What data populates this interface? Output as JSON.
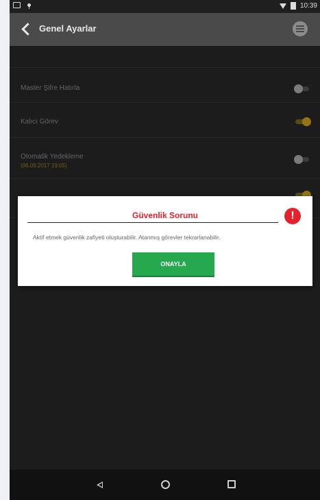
{
  "status_bar": {
    "time": "10:39"
  },
  "app_bar": {
    "title": "Genel Ayarlar"
  },
  "settings": [
    {
      "label": "Master Şifre Hatırla",
      "sub": "",
      "enabled": false
    },
    {
      "label": "Kalıcı Görev",
      "sub": "",
      "enabled": true
    },
    {
      "label": "Otomatik Yedekleme",
      "sub": "(06.09.2017 19:05)",
      "enabled": false
    },
    {
      "label": "",
      "sub": "",
      "enabled": true
    }
  ],
  "dialog": {
    "title": "Güvenlik Sorunu",
    "message": "Aktif etmek güvenlik zafiyeti oluşturabilir. Atanmış görevler tekrarlanabilir.",
    "confirm_label": "ONAYLA"
  },
  "colors": {
    "accent": "#e3b31f",
    "alert": "#e3222c",
    "confirm": "#26a94e"
  },
  "icons": {
    "back": "back-arrow-icon",
    "menu": "menu-icon",
    "alert": "exclamation-icon",
    "nav_back": "nav-back-icon",
    "nav_home": "nav-home-icon",
    "nav_recent": "nav-recent-icon"
  }
}
